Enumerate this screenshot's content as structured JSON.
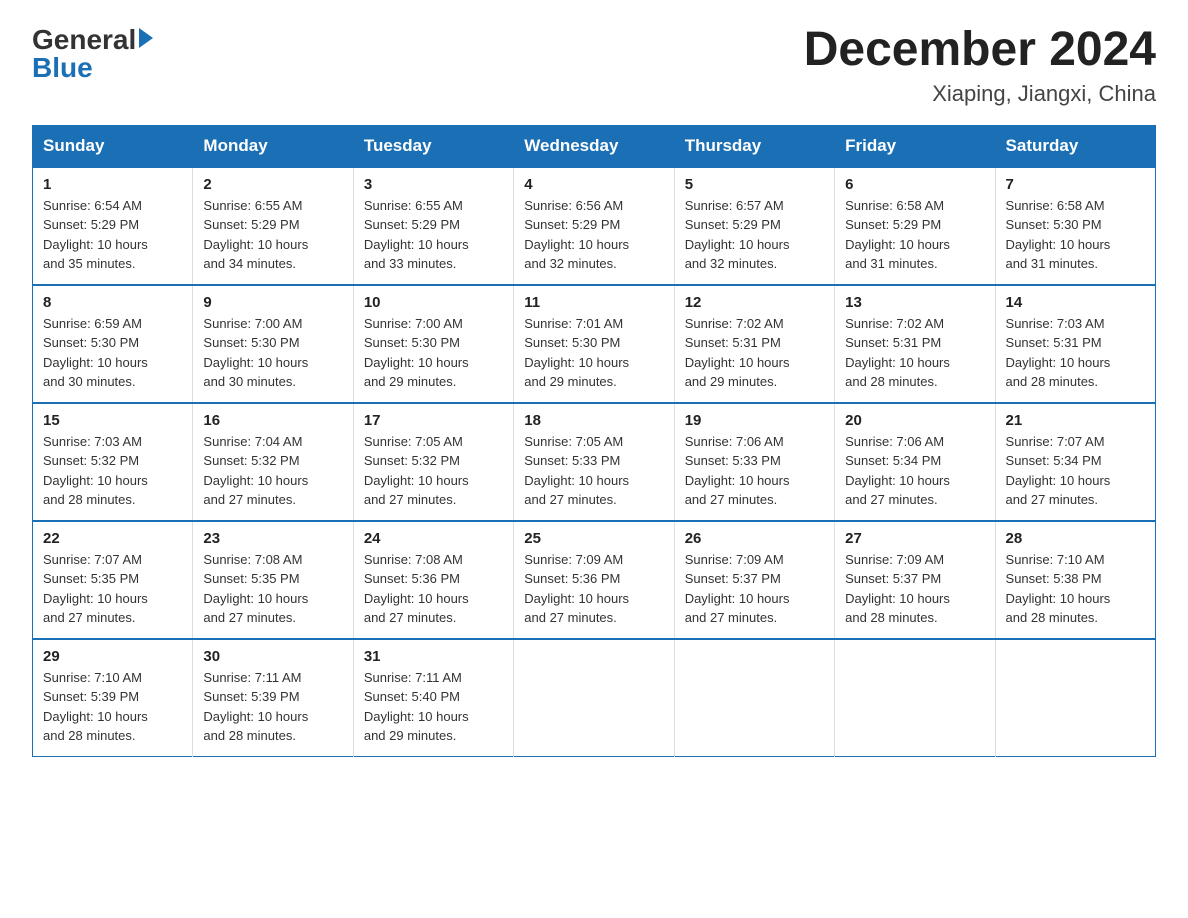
{
  "header": {
    "logo_general": "General",
    "logo_blue": "Blue",
    "title": "December 2024",
    "subtitle": "Xiaping, Jiangxi, China"
  },
  "calendar": {
    "days_of_week": [
      "Sunday",
      "Monday",
      "Tuesday",
      "Wednesday",
      "Thursday",
      "Friday",
      "Saturday"
    ],
    "weeks": [
      [
        {
          "day": "1",
          "info": "Sunrise: 6:54 AM\nSunset: 5:29 PM\nDaylight: 10 hours\nand 35 minutes."
        },
        {
          "day": "2",
          "info": "Sunrise: 6:55 AM\nSunset: 5:29 PM\nDaylight: 10 hours\nand 34 minutes."
        },
        {
          "day": "3",
          "info": "Sunrise: 6:55 AM\nSunset: 5:29 PM\nDaylight: 10 hours\nand 33 minutes."
        },
        {
          "day": "4",
          "info": "Sunrise: 6:56 AM\nSunset: 5:29 PM\nDaylight: 10 hours\nand 32 minutes."
        },
        {
          "day": "5",
          "info": "Sunrise: 6:57 AM\nSunset: 5:29 PM\nDaylight: 10 hours\nand 32 minutes."
        },
        {
          "day": "6",
          "info": "Sunrise: 6:58 AM\nSunset: 5:29 PM\nDaylight: 10 hours\nand 31 minutes."
        },
        {
          "day": "7",
          "info": "Sunrise: 6:58 AM\nSunset: 5:30 PM\nDaylight: 10 hours\nand 31 minutes."
        }
      ],
      [
        {
          "day": "8",
          "info": "Sunrise: 6:59 AM\nSunset: 5:30 PM\nDaylight: 10 hours\nand 30 minutes."
        },
        {
          "day": "9",
          "info": "Sunrise: 7:00 AM\nSunset: 5:30 PM\nDaylight: 10 hours\nand 30 minutes."
        },
        {
          "day": "10",
          "info": "Sunrise: 7:00 AM\nSunset: 5:30 PM\nDaylight: 10 hours\nand 29 minutes."
        },
        {
          "day": "11",
          "info": "Sunrise: 7:01 AM\nSunset: 5:30 PM\nDaylight: 10 hours\nand 29 minutes."
        },
        {
          "day": "12",
          "info": "Sunrise: 7:02 AM\nSunset: 5:31 PM\nDaylight: 10 hours\nand 29 minutes."
        },
        {
          "day": "13",
          "info": "Sunrise: 7:02 AM\nSunset: 5:31 PM\nDaylight: 10 hours\nand 28 minutes."
        },
        {
          "day": "14",
          "info": "Sunrise: 7:03 AM\nSunset: 5:31 PM\nDaylight: 10 hours\nand 28 minutes."
        }
      ],
      [
        {
          "day": "15",
          "info": "Sunrise: 7:03 AM\nSunset: 5:32 PM\nDaylight: 10 hours\nand 28 minutes."
        },
        {
          "day": "16",
          "info": "Sunrise: 7:04 AM\nSunset: 5:32 PM\nDaylight: 10 hours\nand 27 minutes."
        },
        {
          "day": "17",
          "info": "Sunrise: 7:05 AM\nSunset: 5:32 PM\nDaylight: 10 hours\nand 27 minutes."
        },
        {
          "day": "18",
          "info": "Sunrise: 7:05 AM\nSunset: 5:33 PM\nDaylight: 10 hours\nand 27 minutes."
        },
        {
          "day": "19",
          "info": "Sunrise: 7:06 AM\nSunset: 5:33 PM\nDaylight: 10 hours\nand 27 minutes."
        },
        {
          "day": "20",
          "info": "Sunrise: 7:06 AM\nSunset: 5:34 PM\nDaylight: 10 hours\nand 27 minutes."
        },
        {
          "day": "21",
          "info": "Sunrise: 7:07 AM\nSunset: 5:34 PM\nDaylight: 10 hours\nand 27 minutes."
        }
      ],
      [
        {
          "day": "22",
          "info": "Sunrise: 7:07 AM\nSunset: 5:35 PM\nDaylight: 10 hours\nand 27 minutes."
        },
        {
          "day": "23",
          "info": "Sunrise: 7:08 AM\nSunset: 5:35 PM\nDaylight: 10 hours\nand 27 minutes."
        },
        {
          "day": "24",
          "info": "Sunrise: 7:08 AM\nSunset: 5:36 PM\nDaylight: 10 hours\nand 27 minutes."
        },
        {
          "day": "25",
          "info": "Sunrise: 7:09 AM\nSunset: 5:36 PM\nDaylight: 10 hours\nand 27 minutes."
        },
        {
          "day": "26",
          "info": "Sunrise: 7:09 AM\nSunset: 5:37 PM\nDaylight: 10 hours\nand 27 minutes."
        },
        {
          "day": "27",
          "info": "Sunrise: 7:09 AM\nSunset: 5:37 PM\nDaylight: 10 hours\nand 28 minutes."
        },
        {
          "day": "28",
          "info": "Sunrise: 7:10 AM\nSunset: 5:38 PM\nDaylight: 10 hours\nand 28 minutes."
        }
      ],
      [
        {
          "day": "29",
          "info": "Sunrise: 7:10 AM\nSunset: 5:39 PM\nDaylight: 10 hours\nand 28 minutes."
        },
        {
          "day": "30",
          "info": "Sunrise: 7:11 AM\nSunset: 5:39 PM\nDaylight: 10 hours\nand 28 minutes."
        },
        {
          "day": "31",
          "info": "Sunrise: 7:11 AM\nSunset: 5:40 PM\nDaylight: 10 hours\nand 29 minutes."
        },
        {
          "day": "",
          "info": ""
        },
        {
          "day": "",
          "info": ""
        },
        {
          "day": "",
          "info": ""
        },
        {
          "day": "",
          "info": ""
        }
      ]
    ]
  }
}
